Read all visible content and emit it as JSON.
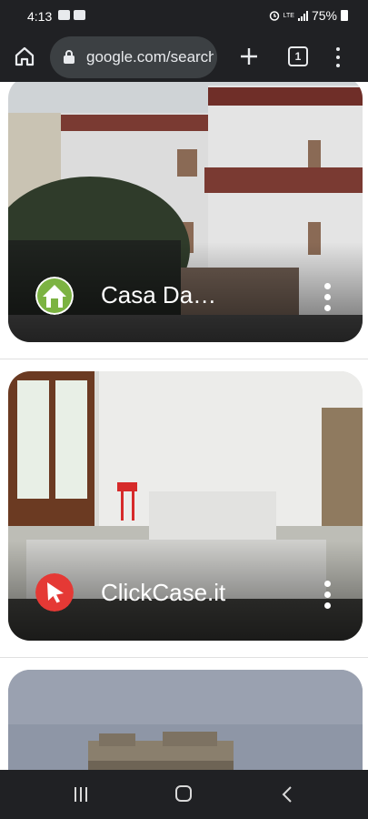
{
  "status_bar": {
    "time": "4:13",
    "network": "LTE",
    "battery": "75%"
  },
  "browser": {
    "url": "google.com/search",
    "tab_count": "1",
    "icons": [
      "home-icon",
      "lock-icon",
      "new-tab-icon",
      "tab-switcher-icon",
      "more-vert-icon"
    ]
  },
  "results": [
    {
      "title": "Casa Da…",
      "favicon": "green-house-icon",
      "favicon_color": "#7cb342"
    },
    {
      "title": "ClickCase.it",
      "favicon": "red-cursor-icon",
      "favicon_color": "#e53935"
    },
    {
      "title": "",
      "favicon": "",
      "favicon_color": ""
    }
  ],
  "nav_bar": {
    "icons": [
      "recent-apps-icon",
      "home-nav-icon",
      "back-icon"
    ]
  },
  "colors": {
    "chrome_dark": "#202124",
    "url_box": "#3c4043",
    "page_bg": "#ffffff"
  }
}
